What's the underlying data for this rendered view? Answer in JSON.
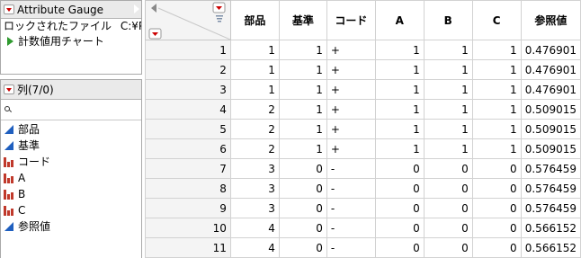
{
  "tables_panel": {
    "title": "Attribute Gauge",
    "locked_file_label": "ロックされたファイル",
    "locked_file_path": "C:¥P",
    "script_label": "計数値用チャート"
  },
  "columns_panel": {
    "title": "列(7/0)",
    "search_placeholder": "",
    "items": [
      {
        "label": "部品",
        "type": "continuous"
      },
      {
        "label": "基準",
        "type": "continuous"
      },
      {
        "label": "コード",
        "type": "nominal"
      },
      {
        "label": "A",
        "type": "nominal"
      },
      {
        "label": "B",
        "type": "nominal"
      },
      {
        "label": "C",
        "type": "nominal"
      },
      {
        "label": "参照値",
        "type": "continuous"
      }
    ]
  },
  "grid": {
    "headers": [
      "部品",
      "基準",
      "コード",
      "A",
      "B",
      "C",
      "参照値"
    ],
    "rows": [
      {
        "n": "1",
        "cells": [
          "1",
          "1",
          "+",
          "1",
          "1",
          "1",
          "0.476901"
        ]
      },
      {
        "n": "2",
        "cells": [
          "1",
          "1",
          "+",
          "1",
          "1",
          "1",
          "0.476901"
        ]
      },
      {
        "n": "3",
        "cells": [
          "1",
          "1",
          "+",
          "1",
          "1",
          "1",
          "0.476901"
        ]
      },
      {
        "n": "4",
        "cells": [
          "2",
          "1",
          "+",
          "1",
          "1",
          "1",
          "0.509015"
        ]
      },
      {
        "n": "5",
        "cells": [
          "2",
          "1",
          "+",
          "1",
          "1",
          "1",
          "0.509015"
        ]
      },
      {
        "n": "6",
        "cells": [
          "2",
          "1",
          "+",
          "1",
          "1",
          "1",
          "0.509015"
        ]
      },
      {
        "n": "7",
        "cells": [
          "3",
          "0",
          "-",
          "0",
          "0",
          "0",
          "0.576459"
        ]
      },
      {
        "n": "8",
        "cells": [
          "3",
          "0",
          "-",
          "0",
          "0",
          "0",
          "0.576459"
        ]
      },
      {
        "n": "9",
        "cells": [
          "3",
          "0",
          "-",
          "0",
          "0",
          "0",
          "0.576459"
        ]
      },
      {
        "n": "10",
        "cells": [
          "4",
          "0",
          "-",
          "0",
          "0",
          "0",
          "0.566152"
        ]
      },
      {
        "n": "11",
        "cells": [
          "4",
          "0",
          "-",
          "0",
          "0",
          "0",
          "0.566152"
        ]
      }
    ]
  },
  "colors": {
    "red_menu": "#cc0000",
    "continuous_icon": "#1f5fbf",
    "nominal_icon": "#c0392b",
    "script_green": "#2f9a2f"
  }
}
